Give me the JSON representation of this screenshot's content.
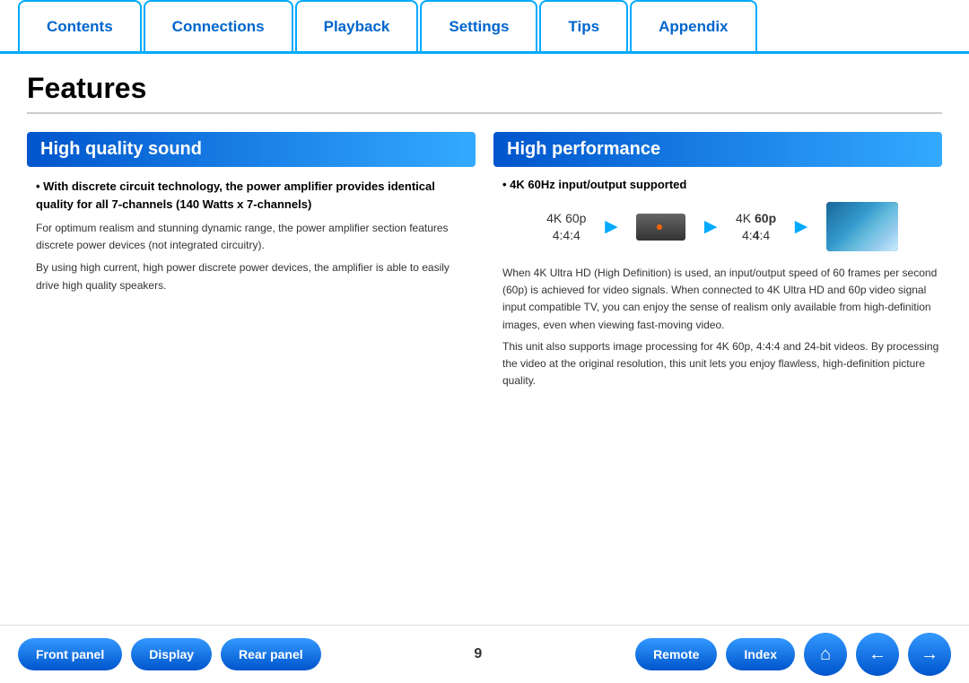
{
  "nav": {
    "tabs": [
      {
        "label": "Contents",
        "id": "contents"
      },
      {
        "label": "Connections",
        "id": "connections"
      },
      {
        "label": "Playback",
        "id": "playback"
      },
      {
        "label": "Settings",
        "id": "settings"
      },
      {
        "label": "Tips",
        "id": "tips"
      },
      {
        "label": "Appendix",
        "id": "appendix"
      }
    ]
  },
  "page": {
    "title": "Features",
    "page_number": "9"
  },
  "left_section": {
    "header": "High quality sound",
    "bullet_bold": "With discrete circuit technology, the power amplifier provides identical quality for all 7-channels (140 Watts x 7-channels)",
    "body1": "For optimum realism and stunning dynamic range, the power amplifier section features discrete power devices (not integrated circuitry).",
    "body2": "By using high current, high power discrete power devices, the amplifier is able to easily drive high quality speakers."
  },
  "right_section": {
    "header": "High performance",
    "bullet_bold": "4K 60Hz input/output supported",
    "input_label_line1": "4K 60p",
    "input_label_line2": "4:4:4",
    "output_label_line1": "4K ",
    "output_label_bold": "60p",
    "output_label_line2_pre": "4:",
    "output_label_bold2": "4",
    "output_label_line2_post": ":4",
    "desc1": "When 4K Ultra HD (High Definition) is used, an input/output speed of 60 frames per second (60p) is achieved for video signals. When connected to 4K Ultra HD and 60p video signal input compatible TV, you can enjoy the sense of realism only available from high-definition images, even when viewing fast-moving video.",
    "desc2": "This unit also supports image processing for 4K 60p, 4:4:4 and 24-bit videos. By processing the video at the original resolution, this unit lets you enjoy flawless, high-definition picture quality."
  },
  "bottom_bar": {
    "btn_front_panel": "Front panel",
    "btn_display": "Display",
    "btn_rear_panel": "Rear panel",
    "btn_remote": "Remote",
    "btn_index": "Index",
    "icon_home": "⌂",
    "icon_back": "←",
    "icon_forward": "→"
  }
}
